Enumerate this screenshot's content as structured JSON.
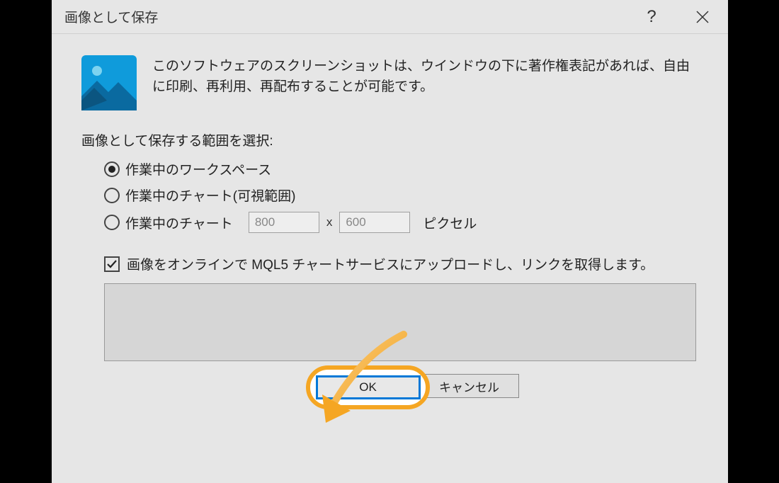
{
  "titlebar": {
    "title": "画像として保存"
  },
  "intro": {
    "text": "このソフトウェアのスクリーンショットは、ウインドウの下に著作権表記があれば、自由に印刷、再利用、再配布することが可能です。"
  },
  "section_label": "画像として保存する範囲を選択:",
  "radios": {
    "workspace": "作業中のワークスペース",
    "chart_visible": "作業中のチャート(可視範囲)",
    "chart_custom": "作業中のチャート"
  },
  "size": {
    "width": "800",
    "height": "600",
    "separator": "x",
    "unit": "ピクセル"
  },
  "upload": {
    "label": "画像をオンラインで MQL5 チャートサービスにアップロードし、リンクを取得します。"
  },
  "buttons": {
    "ok": "OK",
    "cancel": "キャンセル"
  }
}
